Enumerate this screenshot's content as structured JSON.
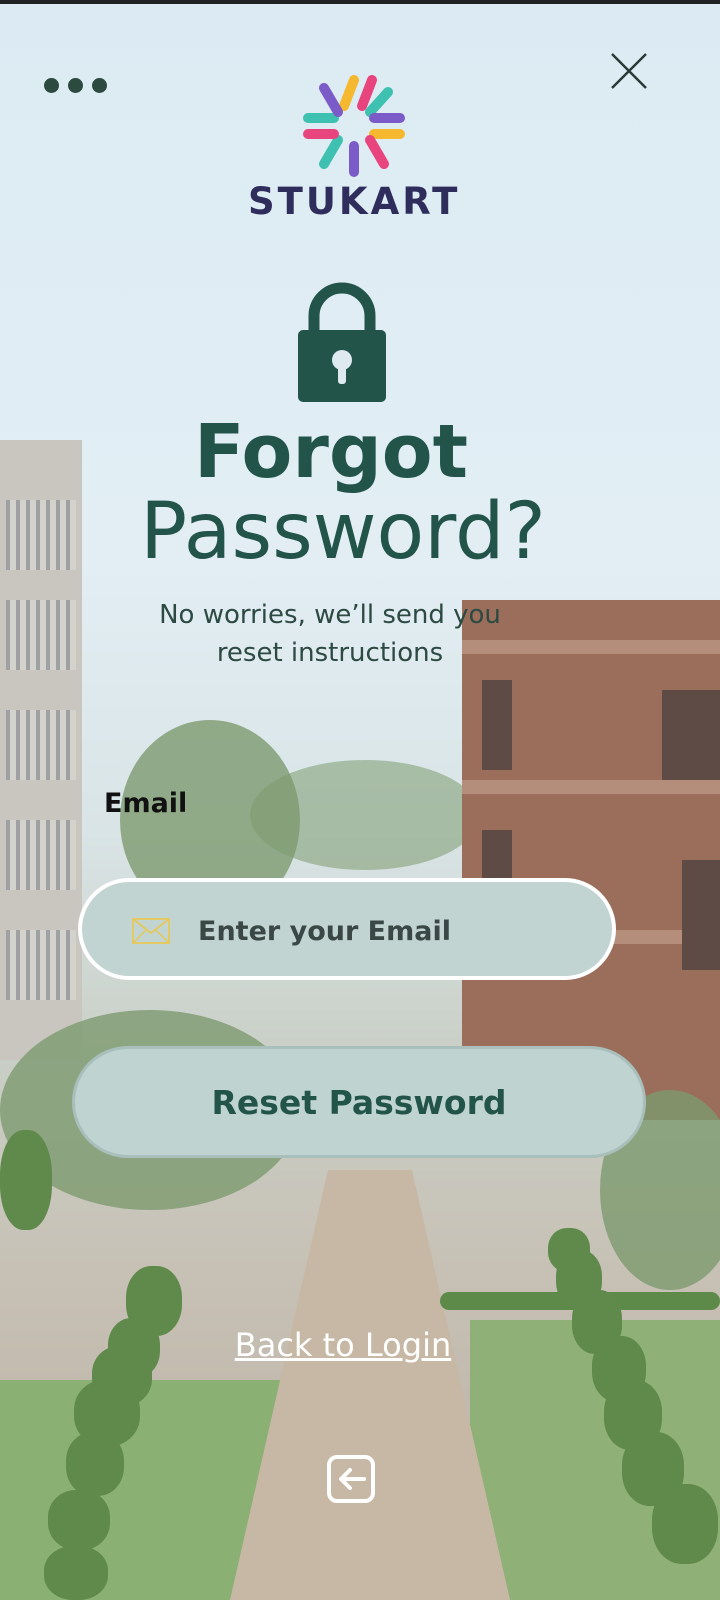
{
  "header": {
    "menu_icon": "more-dots-icon",
    "close_icon": "close-icon"
  },
  "brand": {
    "name": "STUKART",
    "logo_colors": [
      "#f5b82e",
      "#3ec1b0",
      "#e8457f",
      "#7a5bc7"
    ]
  },
  "hero": {
    "icon": "lock-icon",
    "title_line1": "Forgot",
    "title_line2": "Password?",
    "subtitle": "No worries, we’ll send you reset instructions"
  },
  "form": {
    "email_label": "Email",
    "email_value": "",
    "email_placeholder": "Enter your Email",
    "email_icon": "mail-icon",
    "reset_button_label": "Reset Password"
  },
  "footer": {
    "back_link": "Back to Login",
    "exit_icon": "exit-icon"
  },
  "colors": {
    "primary": "#22544a",
    "field_bg": "#c1d4d1",
    "brand_text": "#2e2d5c"
  }
}
